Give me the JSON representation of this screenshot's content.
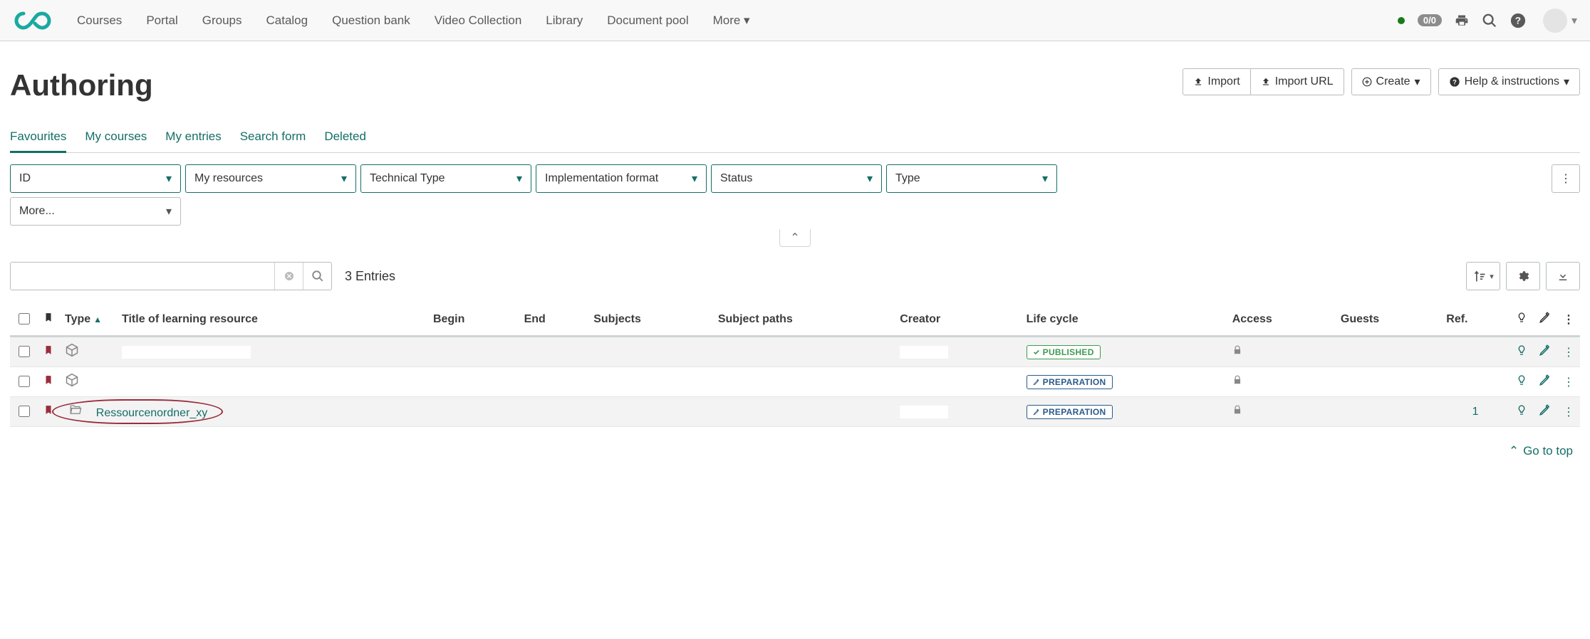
{
  "nav": {
    "items": [
      "Courses",
      "Portal",
      "Groups",
      "Catalog",
      "Question bank",
      "Video Collection",
      "Library",
      "Document pool",
      "More"
    ],
    "sessions_badge": "0/0"
  },
  "header": {
    "title": "Authoring",
    "actions": {
      "import": "Import",
      "import_url": "Import URL",
      "create": "Create",
      "help": "Help & instructions"
    }
  },
  "tabs": [
    "Favourites",
    "My courses",
    "My entries",
    "Search form",
    "Deleted"
  ],
  "active_tab_index": 0,
  "filters": {
    "id": "ID",
    "my_resources": "My resources",
    "tech_type": "Technical Type",
    "impl_format": "Implementation format",
    "status": "Status",
    "type": "Type",
    "more": "More..."
  },
  "search": {
    "placeholder": "",
    "entries_label": "3 Entries"
  },
  "columns": {
    "type": "Type",
    "title": "Title of learning resource",
    "begin": "Begin",
    "end": "End",
    "subjects": "Subjects",
    "subject_paths": "Subject paths",
    "creator": "Creator",
    "lifecycle": "Life cycle",
    "access": "Access",
    "guests": "Guests",
    "ref": "Ref."
  },
  "lifecycle_labels": {
    "published": "PUBLISHED",
    "preparation": "PREPARATION"
  },
  "rows": [
    {
      "type_icon": "cube",
      "title": "",
      "creator": "",
      "lifecycle": "published",
      "access": "locked",
      "ref": ""
    },
    {
      "type_icon": "cube",
      "title": "",
      "creator": "",
      "lifecycle": "preparation",
      "access": "locked",
      "ref": ""
    },
    {
      "type_icon": "folder-open",
      "title": "Ressourcenordner_xy",
      "creator": "",
      "lifecycle": "preparation",
      "access": "locked",
      "ref": "1",
      "circled": true
    }
  ],
  "footer": {
    "go_to_top": "Go to top"
  }
}
